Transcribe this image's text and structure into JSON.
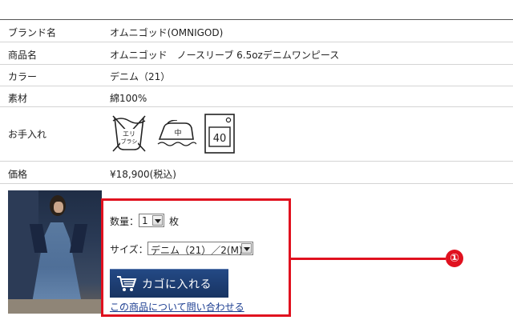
{
  "spec": {
    "brand": {
      "label": "ブランド名",
      "value": "オムニゴッド(OMNIGOD)"
    },
    "product": {
      "label": "商品名",
      "value": "オムニゴッド　ノースリーブ 6.5ozデニムワンピース"
    },
    "color": {
      "label": "カラー",
      "value": "デニム（21）"
    },
    "material": {
      "label": "素材",
      "value": "綿100%"
    },
    "care": {
      "label": "お手入れ",
      "icons": [
        {
          "name": "no-wash-ecru-brush-icon",
          "text": "エリ\nブラシ"
        },
        {
          "name": "iron-medium-icon",
          "text": "中"
        },
        {
          "name": "dry-clean-40-icon",
          "text": "40"
        }
      ]
    },
    "price": {
      "label": "価格",
      "value": "¥18,900(税込)"
    }
  },
  "order": {
    "quantity_label": "数量：",
    "quantity_value": "1",
    "quantity_unit": "枚",
    "size_label": "サイズ：",
    "size_value": "デニム（21）／2(M)",
    "cart_button": "カゴに入れる",
    "inquiry_link": "この商品について問い合わせる"
  },
  "annotation": {
    "number": "①",
    "color": "#e0111f"
  },
  "colors": {
    "button": "#1d3d72",
    "link": "#1a3c90",
    "border": "#d4d4d4"
  }
}
